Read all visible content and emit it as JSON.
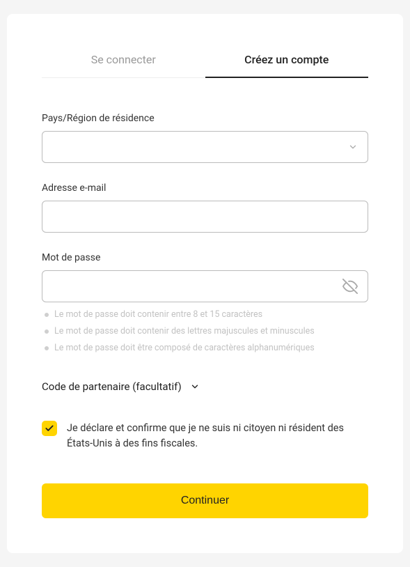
{
  "tabs": {
    "login": "Se connecter",
    "signup": "Créez un compte"
  },
  "fields": {
    "country_label": "Pays/Région de résidence",
    "country_value": "",
    "email_label": "Adresse e-mail",
    "email_value": "",
    "password_label": "Mot de passe",
    "password_value": ""
  },
  "password_rules": [
    "Le mot de passe doit contenir entre 8 et 15 caractères",
    "Le mot de passe doit contenir des lettres majuscules et minuscules",
    "Le mot de passe doit être composé de caractères alphanumériques"
  ],
  "partner": {
    "label": "Code de partenaire (facultatif)"
  },
  "declaration": {
    "text": "Je déclare et confirme que je ne suis ni citoyen ni résident des États-Unis à des fins fiscales.",
    "checked": true
  },
  "buttons": {
    "continue": "Continuer"
  },
  "colors": {
    "accent": "#ffd400"
  }
}
